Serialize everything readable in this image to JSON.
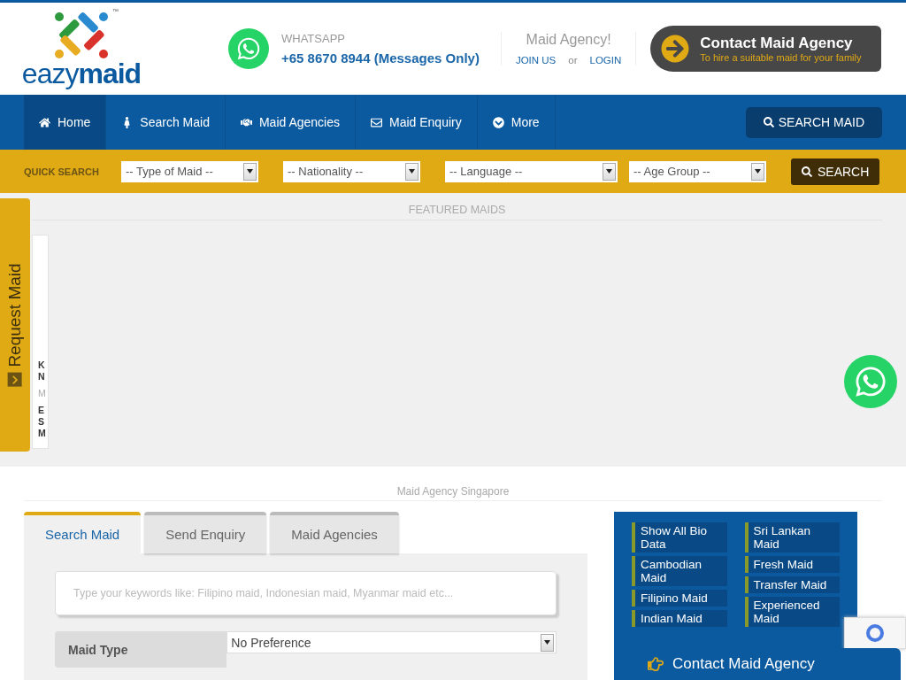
{
  "header": {
    "logo": {
      "text_light": "eazy",
      "text_bold": "maid",
      "trademark": "™"
    },
    "whatsapp": {
      "label": "WHATSAPP",
      "number": "+65 8670 8944 (Messages Only)"
    },
    "account": {
      "title": "Maid Agency!",
      "join": "JOIN US",
      "or": "or",
      "login": "LOGIN"
    },
    "contact_button": {
      "title": "Contact Maid Agency",
      "subtitle": "To hire a suitable maid for your family"
    }
  },
  "nav": {
    "items": [
      {
        "label": "Home",
        "selected": true
      },
      {
        "label": "Search Maid",
        "selected": false
      },
      {
        "label": "Maid Agencies",
        "selected": false
      },
      {
        "label": "Maid Enquiry",
        "selected": false
      },
      {
        "label": "More",
        "selected": false
      }
    ],
    "search_button": "SEARCH MAID"
  },
  "quick_search": {
    "label": "QUICK SEARCH",
    "selects": [
      "-- Type of Maid --",
      "-- Nationality --",
      "-- Language --",
      "-- Age Group --"
    ],
    "button": "SEARCH"
  },
  "featured": {
    "title": "FEATURED MAIDS",
    "request_tab": "Request Maid",
    "card_lines": [
      "K",
      "N",
      "M",
      "E",
      "S",
      "M"
    ]
  },
  "agency_section": {
    "title": "Maid Agency Singapore",
    "tabs": [
      {
        "label": "Search Maid",
        "selected": true
      },
      {
        "label": "Send Enquiry",
        "selected": false
      },
      {
        "label": "Maid Agencies",
        "selected": false
      }
    ],
    "keyword_field": {
      "placeholder": "Type your keywords like: Filipino maid, Indonesian maid, Myanmar maid etc..."
    },
    "maid_type": {
      "label": "Maid Type",
      "value": "No Preference"
    }
  },
  "categories": {
    "column_1": [
      "Show All Bio Data",
      "Cambodian Maid",
      "Filipino Maid",
      "Indian Maid"
    ],
    "column_2": [
      "Sri Lankan Maid",
      "Fresh Maid",
      "Transfer Maid",
      "Experienced Maid"
    ]
  },
  "floating_contact": {
    "label": "Contact Maid Agency"
  }
}
